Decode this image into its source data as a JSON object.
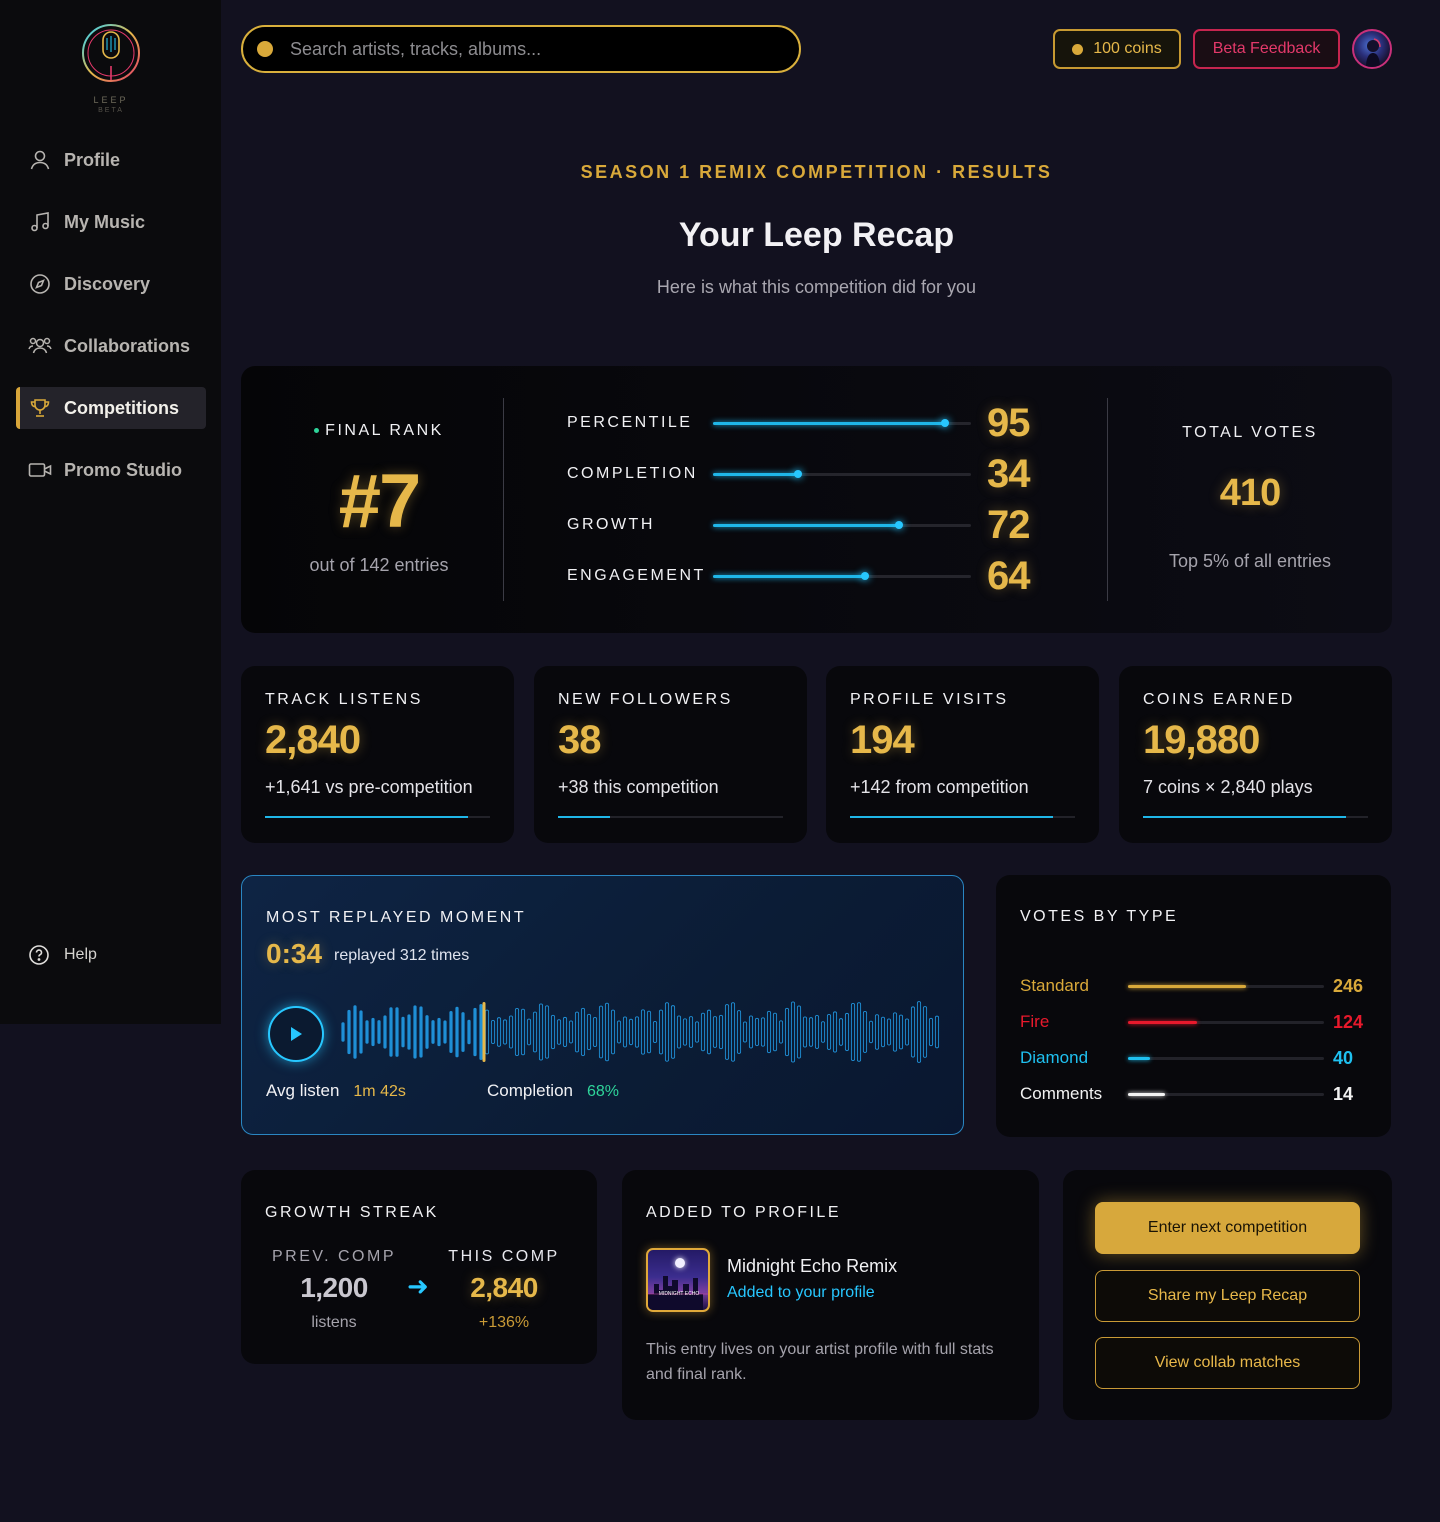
{
  "brand": {
    "name": "LEEP",
    "tag": "BETA",
    "mic_label": "LEEP"
  },
  "sidebar": {
    "items": [
      {
        "label": "Profile",
        "icon": "user-icon"
      },
      {
        "label": "My Music",
        "icon": "music-note-icon"
      },
      {
        "label": "Discovery",
        "icon": "compass-icon"
      },
      {
        "label": "Collaborations",
        "icon": "users-icon"
      },
      {
        "label": "Competitions",
        "icon": "trophy-icon",
        "active": true
      },
      {
        "label": "Promo Studio",
        "icon": "video-camera-icon"
      }
    ],
    "help": "Help"
  },
  "topbar": {
    "search_placeholder": "Search artists, tracks, albums...",
    "coins": "100 coins",
    "feedback": "Beta Feedback"
  },
  "header": {
    "eyebrow": "SEASON 1 REMIX COMPETITION · RESULTS",
    "title": "Your Leep Recap",
    "subtitle": "Here is what this competition did for you"
  },
  "rank": {
    "label": "FINAL RANK",
    "value": "#7",
    "sub": "out of 142 entries",
    "metrics": [
      {
        "label": "PERCENTILE",
        "value": "95",
        "level": 0.9
      },
      {
        "label": "COMPLETION",
        "value": "34",
        "level": 0.33
      },
      {
        "label": "GROWTH",
        "value": "72",
        "level": 0.72
      },
      {
        "label": "ENGAGEMENT",
        "value": "64",
        "level": 0.59
      }
    ],
    "total_votes_label": "TOTAL VOTES",
    "total_votes": "410",
    "total_votes_sub": "Top 5% of all entries"
  },
  "stats": [
    {
      "label": "TRACK LISTENS",
      "value": "2,840",
      "sub": "+1,641 vs pre-competition",
      "level": 0.9
    },
    {
      "label": "NEW FOLLOWERS",
      "value": "38",
      "sub": "+38 this competition",
      "level": 0.23
    },
    {
      "label": "PROFILE VISITS",
      "value": "194",
      "sub": "+142 from competition",
      "level": 0.9
    },
    {
      "label": "COINS EARNED",
      "value": "19,880",
      "sub": "7 coins × 2,840 plays",
      "level": 0.9
    }
  ],
  "replay": {
    "label": "MOST REPLAYED MOMENT",
    "time": "0:34",
    "times_text": "replayed 312 times",
    "avg_label": "Avg listen",
    "avg_value": "1m 42s",
    "completion_label": "Completion",
    "completion_value": "68%",
    "playhead_fraction": 0.24
  },
  "votes_by_type": {
    "label": "VOTES BY TYPE",
    "rows": [
      {
        "name": "Standard",
        "value": "246",
        "level": 0.6,
        "color": "#d9a93a"
      },
      {
        "name": "Fire",
        "value": "124",
        "level": 0.35,
        "color": "#e8192c"
      },
      {
        "name": "Diamond",
        "value": "40",
        "level": 0.11,
        "color": "#1fc0f0"
      },
      {
        "name": "Comments",
        "value": "14",
        "level": 0.19,
        "color": "#f2f2f2"
      }
    ]
  },
  "streak": {
    "label": "GROWTH STREAK",
    "prev_label": "PREV. COMP",
    "prev_value": "1,200",
    "prev_sub": "listens",
    "this_label": "THIS COMP",
    "this_value": "2,840",
    "this_sub": "+136%"
  },
  "added": {
    "label": "ADDED TO PROFILE",
    "cover_text": "MIDNIGHT ECHO",
    "track_title": "Midnight Echo Remix",
    "track_sub": "Added to your profile",
    "desc": "This entry lives on your artist profile with full stats and final rank."
  },
  "actions": {
    "primary": "Enter next competition",
    "share": "Share my Leep Recap",
    "collab": "View collab matches"
  },
  "colors": {
    "accent": "#d9a93a",
    "cyan": "#1fb6e8",
    "bg": "#12111f"
  }
}
